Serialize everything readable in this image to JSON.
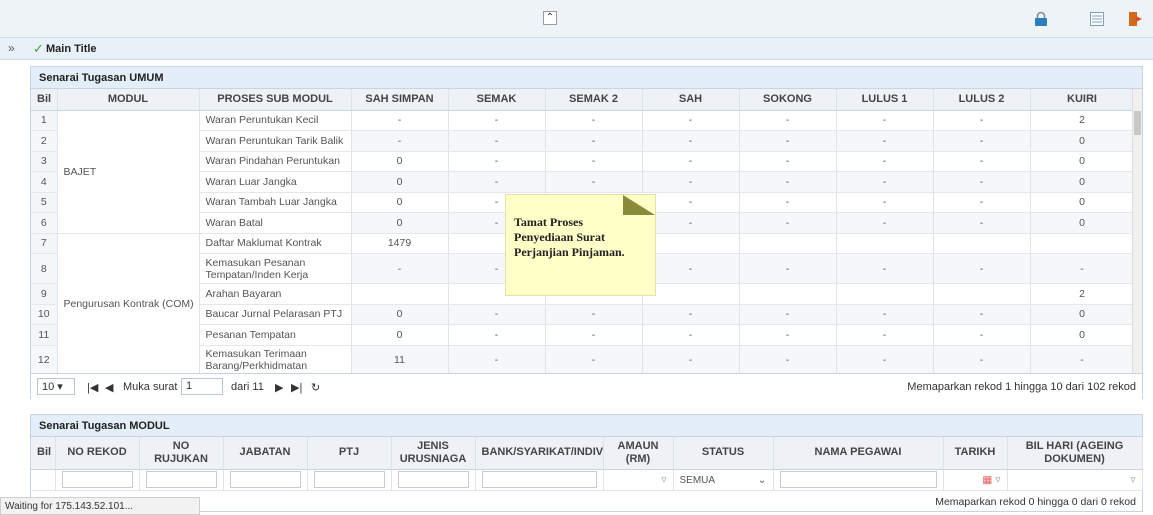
{
  "title_bar": {
    "title": "Main Title"
  },
  "umum": {
    "panel_title": "Senarai Tugasan UMUM",
    "headers": [
      "Bil",
      "MODUL",
      "PROSES SUB MODUL",
      "SAH SIMPAN",
      "SEMAK",
      "SEMAK 2",
      "SAH",
      "SOKONG",
      "LULUS 1",
      "LULUS 2",
      "KUIRI"
    ],
    "groups": [
      "BAJET",
      "Pengurusan Kontrak (COM)"
    ],
    "rows": [
      {
        "bil": "1",
        "proses": "Waran Peruntukan Kecil",
        "sah_simpan": "-",
        "semak": "-",
        "semak2": "-",
        "sah": "-",
        "sokong": "-",
        "lulus1": "-",
        "lulus2": "-",
        "kuiri": "2"
      },
      {
        "bil": "2",
        "proses": "Waran Peruntukan Tarik Balik",
        "sah_simpan": "-",
        "semak": "-",
        "semak2": "-",
        "sah": "-",
        "sokong": "-",
        "lulus1": "-",
        "lulus2": "-",
        "kuiri": "0"
      },
      {
        "bil": "3",
        "proses": "Waran Pindahan Peruntukan",
        "sah_simpan": "0",
        "semak": "-",
        "semak2": "-",
        "sah": "-",
        "sokong": "-",
        "lulus1": "-",
        "lulus2": "-",
        "kuiri": "0"
      },
      {
        "bil": "4",
        "proses": "Waran Luar Jangka",
        "sah_simpan": "0",
        "semak": "-",
        "semak2": "-",
        "sah": "-",
        "sokong": "-",
        "lulus1": "-",
        "lulus2": "-",
        "kuiri": "0"
      },
      {
        "bil": "5",
        "proses": "Waran Tambah Luar Jangka",
        "sah_simpan": "0",
        "semak": "-",
        "semak2": "",
        "sah": "-",
        "sokong": "-",
        "lulus1": "-",
        "lulus2": "-",
        "kuiri": "0"
      },
      {
        "bil": "6",
        "proses": "Waran Batal",
        "sah_simpan": "0",
        "semak": "-",
        "semak2": "",
        "sah": "-",
        "sokong": "-",
        "lulus1": "-",
        "lulus2": "-",
        "kuiri": "0"
      },
      {
        "bil": "7",
        "proses": "Daftar Maklumat Kontrak",
        "sah_simpan": "1479",
        "semak": "",
        "semak2": "",
        "sah": "",
        "sokong": "",
        "lulus1": "",
        "lulus2": "",
        "kuiri": ""
      },
      {
        "bil": "8",
        "proses": "Kemasukan Pesanan Tempatan/Inden Kerja",
        "sah_simpan": "-",
        "semak": "-",
        "semak2": "",
        "sah": "-",
        "sokong": "-",
        "lulus1": "-",
        "lulus2": "-",
        "kuiri": "-"
      },
      {
        "bil": "9",
        "proses": "Arahan Bayaran",
        "sah_simpan": "",
        "semak": "",
        "semak2": "",
        "sah": "",
        "sokong": "",
        "lulus1": "",
        "lulus2": "",
        "kuiri": "2"
      },
      {
        "bil": "10",
        "proses": "Baucar Jurnal Pelarasan PTJ",
        "sah_simpan": "0",
        "semak": "-",
        "semak2": "-",
        "sah": "-",
        "sokong": "-",
        "lulus1": "-",
        "lulus2": "-",
        "kuiri": "0"
      },
      {
        "bil": "11",
        "proses": "Pesanan Tempatan",
        "sah_simpan": "0",
        "semak": "-",
        "semak2": "-",
        "sah": "-",
        "sokong": "-",
        "lulus1": "-",
        "lulus2": "-",
        "kuiri": "0"
      },
      {
        "bil": "12",
        "proses": "Kemasukan Terimaan Barang/Perkhidmatan",
        "sah_simpan": "11",
        "semak": "-",
        "semak2": "-",
        "sah": "-",
        "sokong": "-",
        "lulus1": "-",
        "lulus2": "-",
        "kuiri": "-"
      }
    ],
    "pager": {
      "page_size": "10",
      "page_label": "Muka surat",
      "page_value": "1",
      "of_label": "dari 11",
      "info": "Memaparkan rekod 1 hingga 10 dari 102 rekod"
    }
  },
  "tooltip": {
    "line1": "Tamat Proses",
    "line2": "Penyediaan Surat",
    "line3": "Perjanjian Pinjaman."
  },
  "modul": {
    "panel_title": "Senarai Tugasan MODUL",
    "headers": [
      "Bil",
      "NO REKOD",
      "NO RUJUKAN",
      "JABATAN",
      "PTJ",
      "JENIS URUSNIAGA",
      "BANK/SYARIKAT/INDIVID",
      "AMAUN (RM)",
      "STATUS",
      "NAMA PEGAWAI",
      "TARIKH",
      "BIL HARI (AGEING DOKUMEN)"
    ],
    "status_value": "SEMUA",
    "info": "Memaparkan rekod 0 hingga 0 dari 0 rekod"
  },
  "status_bar": {
    "text": "Waiting for 175.143.52.101..."
  }
}
